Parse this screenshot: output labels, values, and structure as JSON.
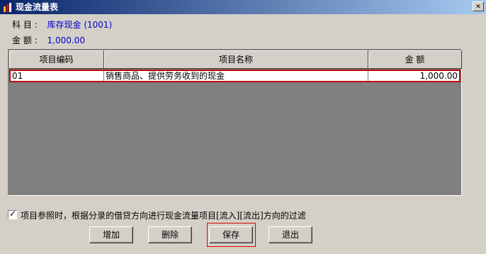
{
  "window": {
    "title": "现金流量表",
    "close_glyph": "×"
  },
  "info": {
    "subject_label": "科 目 :",
    "subject_value": "库存现金 (1001)",
    "amount_label": "金 额 :",
    "amount_value": "1,000.00"
  },
  "table": {
    "columns": [
      "项目编码",
      "项目名称",
      "金 额"
    ],
    "rows": [
      {
        "code": "01",
        "name": "销售商品、提供劳务收到的现金",
        "amount": "1,000.00"
      }
    ]
  },
  "filter_option": {
    "checked": true,
    "label": "项目参照时，根据分录的借贷方向进行现金流量项目[流入][流出]方向的过滤"
  },
  "buttons": {
    "add": "增加",
    "delete": "删除",
    "save": "保存",
    "exit": "退出"
  },
  "colors": {
    "title_start": "#0a246a",
    "title_end": "#a6caf0",
    "value_blue": "#0000c8",
    "highlight_red": "#c00000",
    "grid_bg": "#808080"
  }
}
